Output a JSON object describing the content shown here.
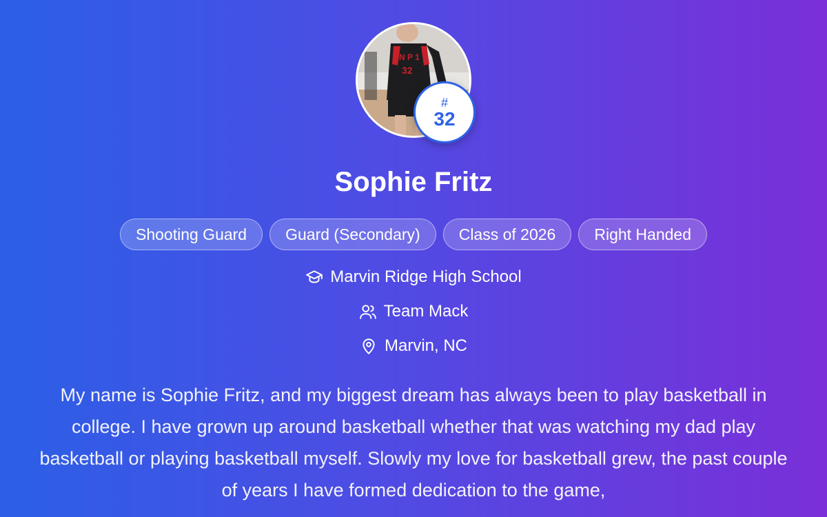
{
  "player": {
    "name": "Sophie Fritz",
    "jersey_hash": "#",
    "jersey_number": "32",
    "avatar_alt": "player-photo"
  },
  "tags": [
    "Shooting Guard",
    "Guard (Secondary)",
    "Class of 2026",
    "Right Handed"
  ],
  "info": {
    "school": "Marvin Ridge High School",
    "school_icon": "graduation-cap-icon",
    "team": "Team Mack",
    "team_icon": "users-icon",
    "location": "Marvin, NC",
    "location_icon": "map-pin-icon"
  },
  "bio": "My name is Sophie Fritz, and my biggest dream has always been to play basketball in college. I have grown up around basketball whether that was watching my dad play basketball or playing basketball myself. Slowly my love for basketball grew, the past couple of years I have formed dedication to the game,",
  "colors": {
    "gradient_start": "#2b5fe6",
    "gradient_end": "#7a2fd8",
    "badge_accent": "#2f63e5"
  }
}
